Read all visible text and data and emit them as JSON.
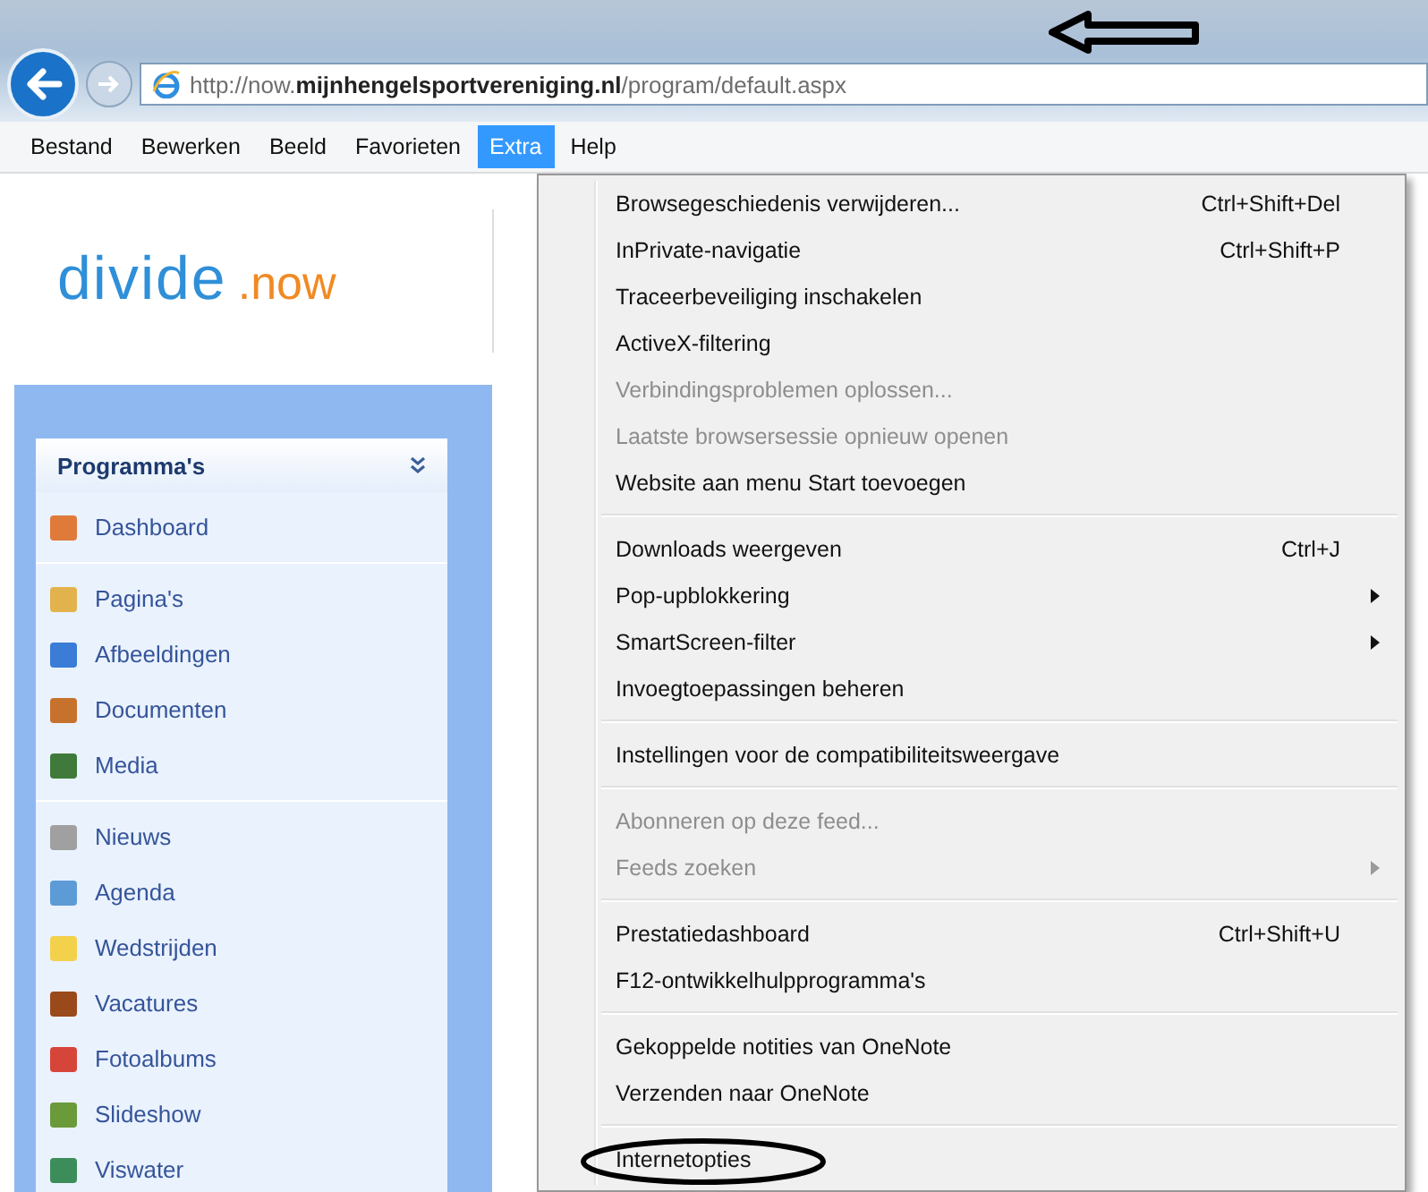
{
  "browser": {
    "address": "http://now.**mijnhengelsportvereniging.nl**/program/default.aspx"
  },
  "menubar": [
    {
      "label": "Bestand",
      "selected": false
    },
    {
      "label": "Bewerken",
      "selected": false
    },
    {
      "label": "Beeld",
      "selected": false
    },
    {
      "label": "Favorieten",
      "selected": false
    },
    {
      "label": "Extra",
      "selected": true
    },
    {
      "label": "Help",
      "selected": false
    }
  ],
  "logo": {
    "word": "divide",
    "suffix": ".now"
  },
  "sidebar": {
    "title": "Programma's",
    "groups": [
      [
        {
          "label": "Dashboard"
        }
      ],
      [
        {
          "label": "Pagina's"
        },
        {
          "label": "Afbeeldingen"
        },
        {
          "label": "Documenten"
        },
        {
          "label": "Media"
        }
      ],
      [
        {
          "label": "Nieuws"
        },
        {
          "label": "Agenda"
        },
        {
          "label": "Wedstrijden"
        },
        {
          "label": "Vacatures"
        },
        {
          "label": "Fotoalbums"
        },
        {
          "label": "Slideshow"
        },
        {
          "label": "Viswater"
        }
      ]
    ]
  },
  "menu": {
    "items": [
      {
        "kind": "item",
        "label": "Browsegeschiedenis verwijderen...",
        "shortcut": "Ctrl+Shift+Del",
        "disabled": false,
        "submenu": false
      },
      {
        "kind": "item",
        "label": "InPrivate-navigatie",
        "shortcut": "Ctrl+Shift+P",
        "disabled": false,
        "submenu": false
      },
      {
        "kind": "item",
        "label": "Traceerbeveiliging inschakelen",
        "disabled": false,
        "submenu": false
      },
      {
        "kind": "item",
        "label": "ActiveX-filtering",
        "disabled": false,
        "submenu": false
      },
      {
        "kind": "item",
        "label": "Verbindingsproblemen oplossen...",
        "disabled": true,
        "submenu": false
      },
      {
        "kind": "item",
        "label": "Laatste browsersessie opnieuw openen",
        "disabled": true,
        "submenu": false
      },
      {
        "kind": "item",
        "label": "Website aan menu Start toevoegen",
        "disabled": false,
        "submenu": false
      },
      {
        "kind": "separator"
      },
      {
        "kind": "item",
        "label": "Downloads weergeven",
        "shortcut": "Ctrl+J",
        "disabled": false,
        "submenu": false
      },
      {
        "kind": "item",
        "label": "Pop-upblokkering",
        "disabled": false,
        "submenu": true
      },
      {
        "kind": "item",
        "label": "SmartScreen-filter",
        "disabled": false,
        "submenu": true
      },
      {
        "kind": "item",
        "label": "Invoegtoepassingen beheren",
        "disabled": false,
        "submenu": false
      },
      {
        "kind": "separator"
      },
      {
        "kind": "item",
        "label": "Instellingen voor de compatibiliteitsweergave",
        "disabled": false,
        "submenu": false
      },
      {
        "kind": "separator"
      },
      {
        "kind": "item",
        "label": "Abonneren op deze feed...",
        "disabled": true,
        "submenu": false
      },
      {
        "kind": "item",
        "label": "Feeds zoeken",
        "disabled": true,
        "submenu": true
      },
      {
        "kind": "separator"
      },
      {
        "kind": "item",
        "label": "Prestatiedashboard",
        "shortcut": "Ctrl+Shift+U",
        "disabled": false,
        "submenu": false
      },
      {
        "kind": "item",
        "label": "F12-ontwikkelhulpprogramma's",
        "disabled": false,
        "submenu": false
      },
      {
        "kind": "separator"
      },
      {
        "kind": "item",
        "label": "Gekoppelde notities van OneNote",
        "disabled": false,
        "submenu": false
      },
      {
        "kind": "item",
        "label": "Verzenden naar OneNote",
        "disabled": false,
        "submenu": false
      },
      {
        "kind": "separator"
      },
      {
        "kind": "item",
        "label": "Internetopties",
        "disabled": false,
        "submenu": false,
        "circled": true
      }
    ]
  }
}
